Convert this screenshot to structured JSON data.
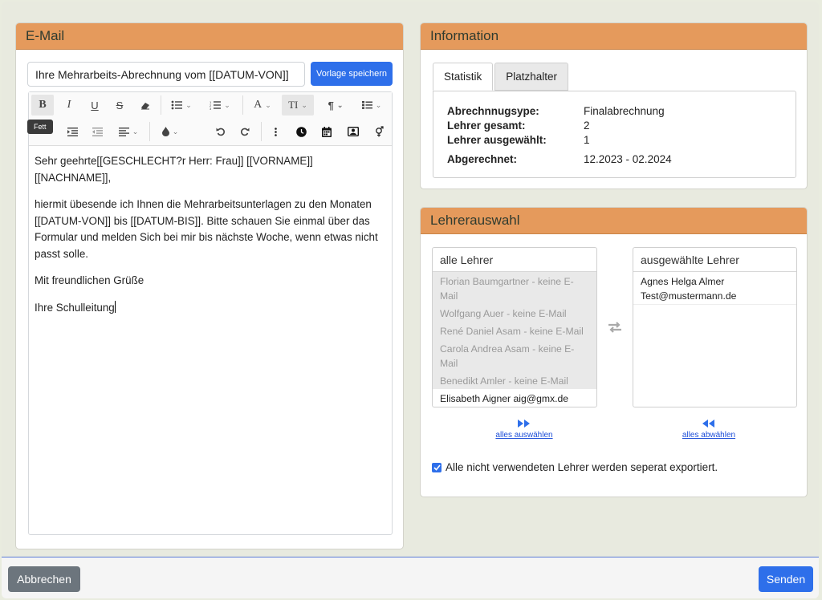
{
  "email": {
    "header": "E-Mail",
    "subject_value": "Ihre Mehrarbeits-Abrechnung vom [[DATUM-VON]]",
    "save_template_label": "Vorlage speichern",
    "tooltip_bold": "Fett",
    "toolbar": {
      "bold": "B",
      "italic": "I",
      "underline": "U",
      "strike": "S",
      "font": "A",
      "text_size": "TI",
      "paragraph": "¶"
    },
    "body_lines": [
      "Sehr geehrte[[GESCHLECHT?r Herr: Frau]] [[VORNAME]] [[NACHNAME]],",
      "hiermit übesende ich Ihnen die Mehrarbeitsunterlagen zu den Monaten [[DATUM-VON]] bis [[DATUM-BIS]]. Bitte schauen Sie einmal über das Formular und melden Sich bei mir bis nächste Woche, wenn etwas nicht passt solle.",
      "Mit freundlichen Grüße",
      "Ihre Schulleitung"
    ]
  },
  "info": {
    "header": "Information",
    "tabs": [
      "Statistik",
      "Platzhalter"
    ],
    "stats": [
      {
        "label": "Abrechnnugsype:",
        "value": "Finalabrechnung"
      },
      {
        "label": "Lehrer gesamt:",
        "value": "2"
      },
      {
        "label": "Lehrer ausgewählt:",
        "value": "1"
      },
      {
        "label": "Abgerechnet:",
        "value": "12.2023 - 02.2024"
      }
    ]
  },
  "teachers": {
    "header": "Lehrerauswahl",
    "all_header": "alle Lehrer",
    "selected_header": "ausgewählte Lehrer",
    "all_list": [
      {
        "line1": "Florian Baumgartner - keine E-",
        "line2": "Mail",
        "disabled": true
      },
      {
        "line1": "Wolfgang Auer - keine E-Mail",
        "line2": "",
        "disabled": true
      },
      {
        "line1": "René Daniel Asam - keine E-Mail",
        "line2": "",
        "disabled": true
      },
      {
        "line1": "Carola Andrea Asam - keine E-",
        "line2": "Mail",
        "disabled": true
      },
      {
        "line1": "Benedikt Amler - keine E-Mail",
        "line2": "",
        "disabled": true
      },
      {
        "line1": "Elisabeth Aigner aig@gmx.de",
        "line2": "",
        "disabled": false
      }
    ],
    "selected_list": [
      {
        "line1": "Agnes Helga Almer",
        "line2": "Test@mustermann.de"
      }
    ],
    "select_all": "alles auswählen",
    "deselect_all": "alles abwählen",
    "export_checkbox_label": "Alle nicht verwendeten Lehrer werden seperat exportiert.",
    "export_checked": true
  },
  "footer": {
    "cancel": "Abbrechen",
    "send": "Senden"
  },
  "colors": {
    "panel_header": "#e59a5c",
    "primary": "#2e6fea",
    "secondary": "#6c757d"
  }
}
